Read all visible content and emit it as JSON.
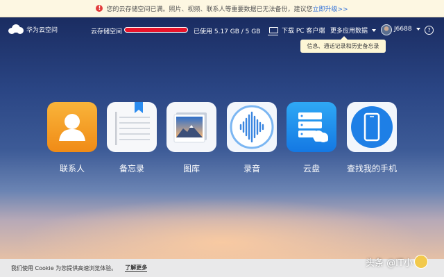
{
  "banner": {
    "text": "您的云存储空间已满。照片、视频、联系人等重要数据已无法备份，建议您",
    "link": "立即升级>>"
  },
  "header": {
    "logo_text": "华为云空间",
    "storage_label": "云存储空间",
    "storage_used": 1.0,
    "storage_text": "已使用  5.17 GB / 5 GB",
    "download_label": "下载 PC 客户端",
    "more_label": "更多应用数据",
    "username": "J6688",
    "help": "?",
    "tooltip": "信息、通话记录和历史备忘录"
  },
  "apps": [
    {
      "label": "联系人"
    },
    {
      "label": "备忘录"
    },
    {
      "label": "图库"
    },
    {
      "label": "录音"
    },
    {
      "label": "云盘"
    },
    {
      "label": "查找我的手机"
    }
  ],
  "cookie": {
    "text": "我们使用 Cookie 为您提供高速浏览体验。",
    "link": "了解更多"
  },
  "watermark": "头条 @IT小"
}
